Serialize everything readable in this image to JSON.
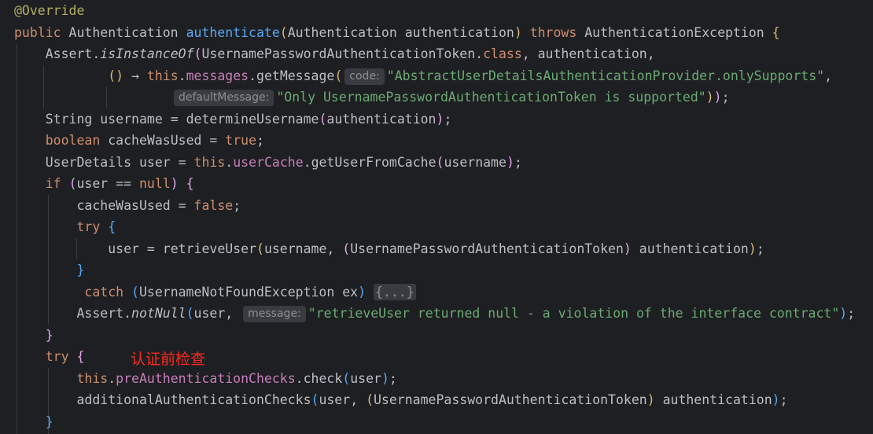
{
  "code": {
    "annotation": "@Override",
    "kw_public": "public",
    "type_authentication": "Authentication",
    "method_authenticate": "authenticate",
    "param_authentication": "authentication",
    "kw_throws": "throws",
    "type_auth_exception": "AuthenticationException",
    "assert_class": "Assert",
    "method_is_instance_of": "isInstanceOf",
    "type_token": "UsernamePasswordAuthenticationToken",
    "kw_class": "class",
    "arrow": "→",
    "kw_this": "this",
    "field_messages": "messages",
    "method_get_message": "getMessage",
    "hint_code": "code:",
    "str_only_supports": "\"AbstractUserDetailsAuthenticationProvider.onlySupports\"",
    "hint_default_message": "defaultMessage:",
    "str_only_token": "\"Only UsernamePasswordAuthenticationToken is supported\"",
    "type_string": "String",
    "var_username": "username",
    "method_determine_username": "determineUsername",
    "kw_boolean": "boolean",
    "var_cache_was_used": "cacheWasUsed",
    "kw_true": "true",
    "type_user_details": "UserDetails",
    "var_user": "user",
    "field_user_cache": "userCache",
    "method_get_user_from_cache": "getUserFromCache",
    "kw_if": "if",
    "op_equals": "==",
    "kw_null": "null",
    "kw_false": "false",
    "kw_try": "try",
    "method_retrieve_user": "retrieveUser",
    "kw_catch": "catch",
    "type_not_found": "UsernameNotFoundException",
    "var_ex": "ex",
    "folded_block": "{...}",
    "method_not_null": "notNull",
    "hint_message": "message:",
    "str_retrieve_null": "\"retrieveUser returned null - a violation of the interface contract\"",
    "field_pre_checks": "preAuthenticationChecks",
    "method_check": "check",
    "method_additional_checks": "additionalAuthenticationChecks"
  },
  "note": {
    "pre_check": "认证前检查"
  },
  "colors": {
    "background": "#1e1f22",
    "default_text": "#bcbec4",
    "keyword": "#cf8e6d",
    "method_declaration": "#56a8f5",
    "field": "#c77dbb",
    "string": "#6aab73",
    "annotation": "#b3ae60",
    "note_red": "#ff2a1f"
  }
}
